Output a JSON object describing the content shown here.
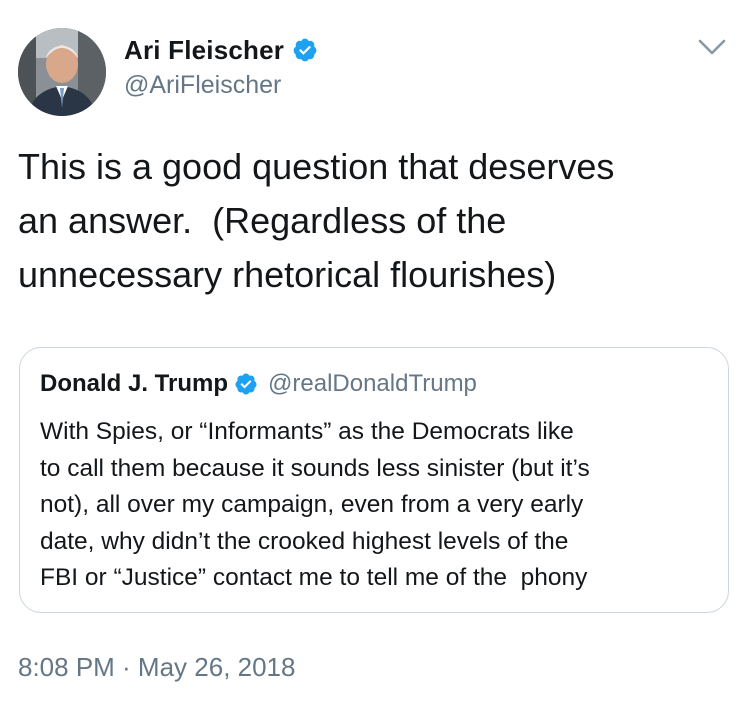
{
  "author": {
    "display_name": "Ari Fleischer",
    "handle": "@AriFleischer",
    "verified": true,
    "avatar_icon": "profile-photo"
  },
  "tweet": {
    "text": "This is a good question that deserves\nan answer.  (Regardless of the\nunnecessary rhetorical flourishes)",
    "timestamp": "8:08 PM · May 26, 2018"
  },
  "quoted_tweet": {
    "display_name": "Donald J. Trump",
    "handle": "@realDonaldTrump",
    "verified": true,
    "text": "With Spies, or “Informants” as the Democrats like\nto call them because it sounds less sinister (but it’s\nnot), all over my campaign, even from a very early\ndate, why didn’t the crooked highest levels of the\nFBI or “Justice” contact me to tell me of the  phony"
  },
  "icons": {
    "verified": "verified-badge-icon",
    "menu": "chevron-down-icon"
  },
  "colors": {
    "verified_blue": "#1da1f2",
    "secondary_text": "#657786",
    "border": "#ccd6dd"
  }
}
